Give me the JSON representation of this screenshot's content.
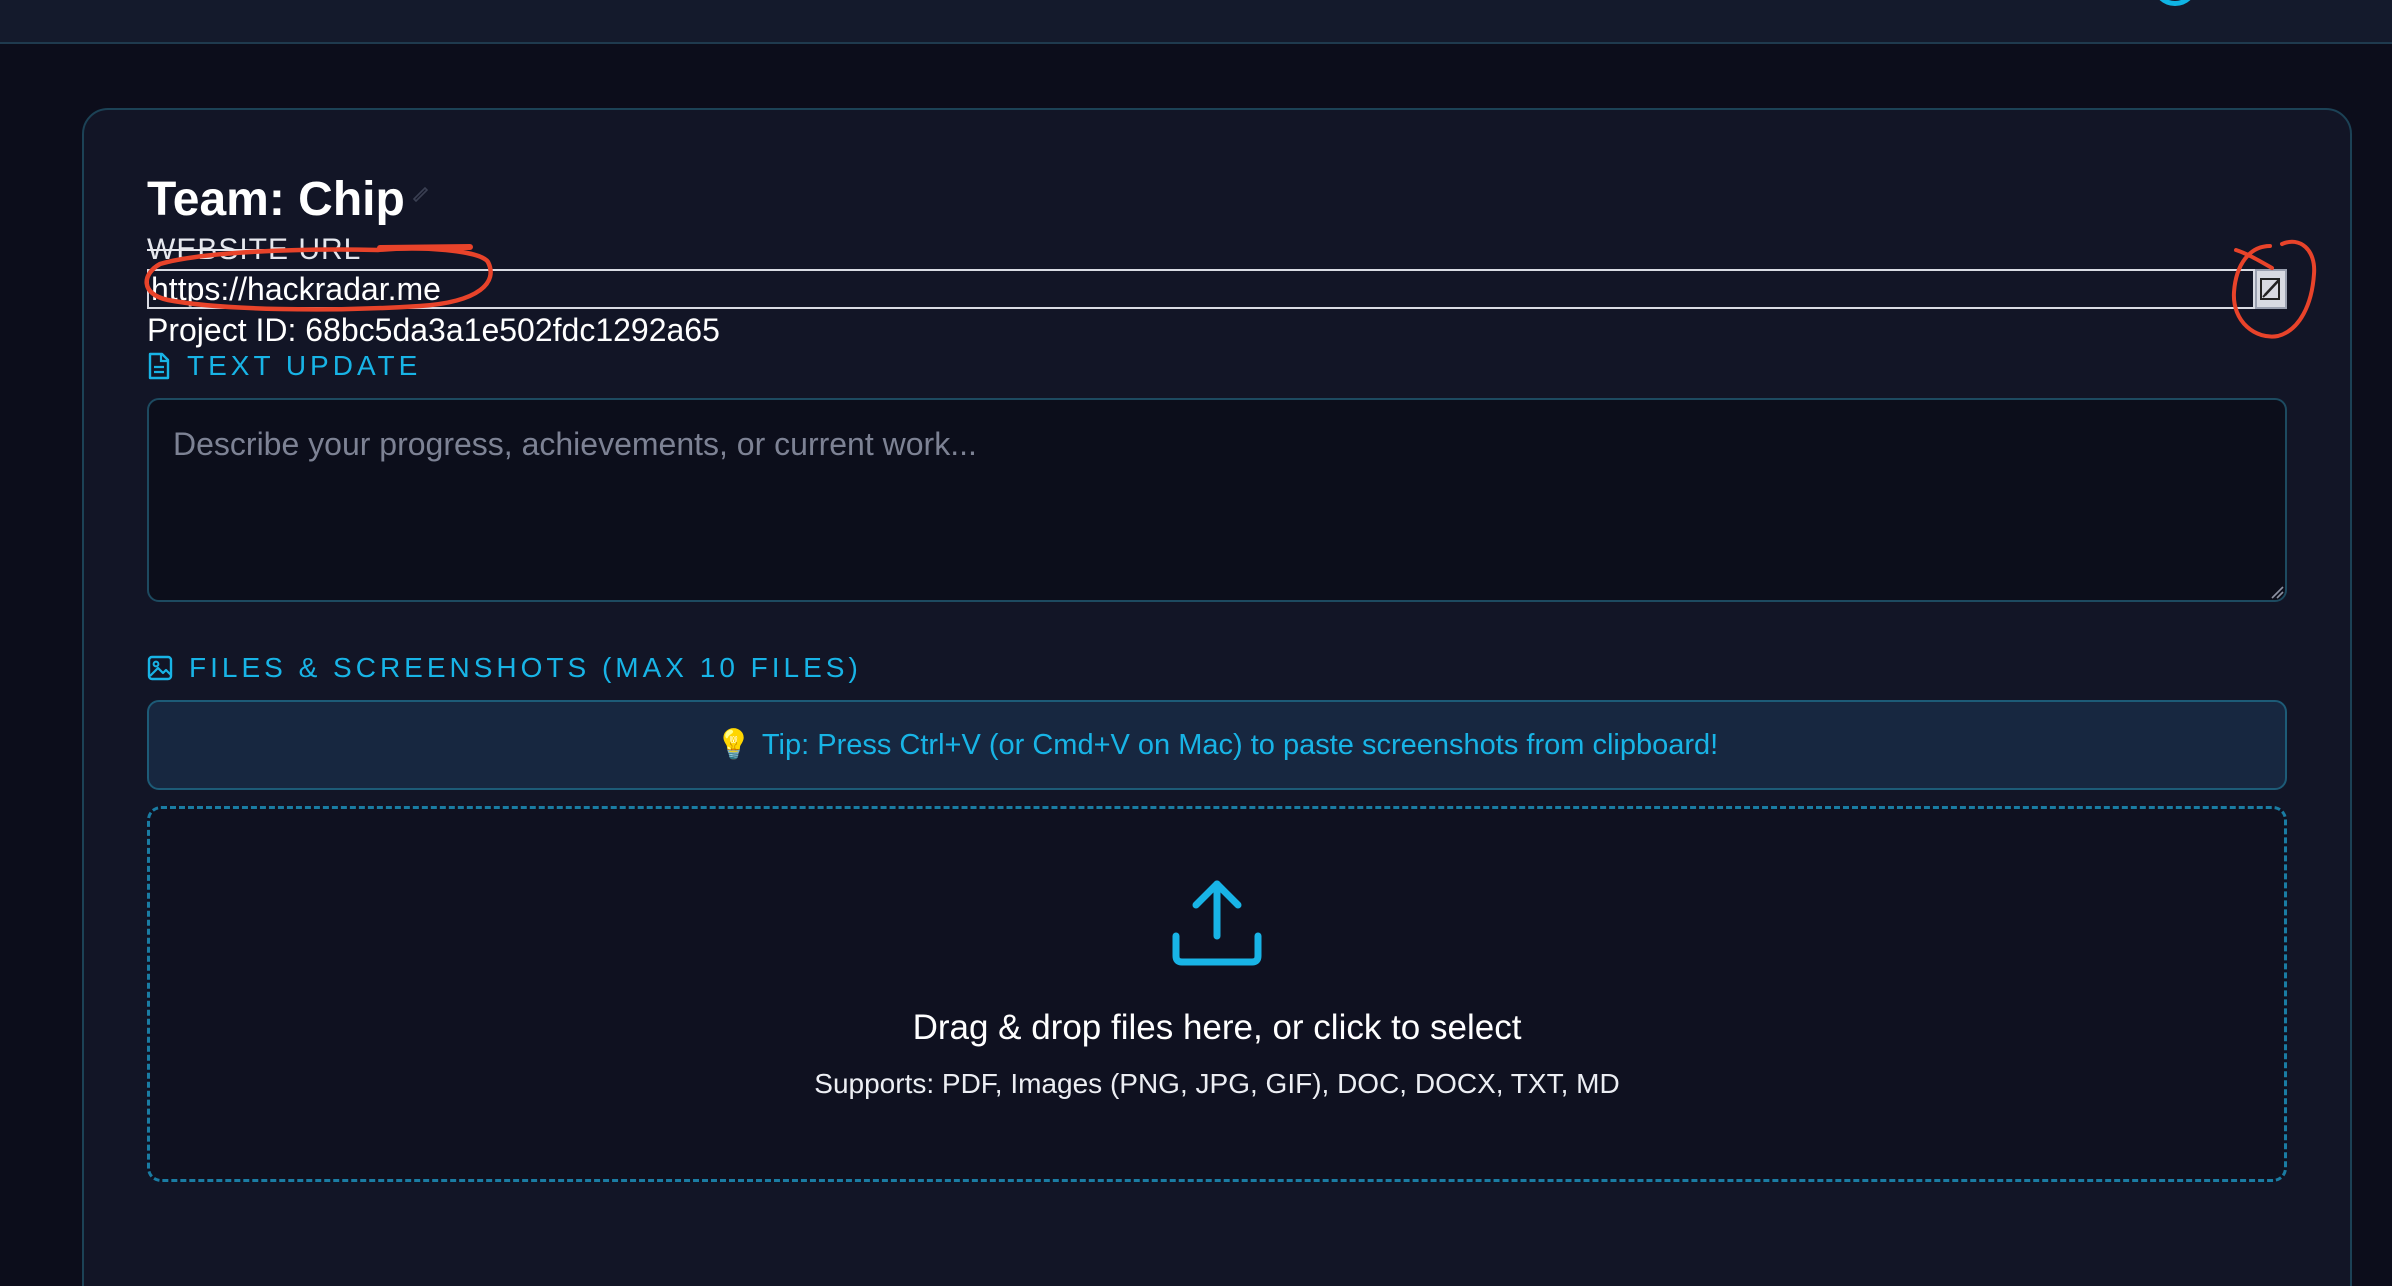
{
  "card": {
    "team_title": "Team: Chip",
    "website_label": "WEBSITE URL",
    "website_url": "https://hackradar.me",
    "project_id": "Project ID: 68bc5da3a1e502fdc1292a65"
  },
  "text_update": {
    "section_label": "TEXT UPDATE",
    "placeholder": "Describe your progress, achievements, or current work..."
  },
  "files": {
    "section_label": "FILES & SCREENSHOTS (MAX 10 FILES)",
    "tip_icon": "💡",
    "tip_text": "Tip: Press Ctrl+V (or Cmd+V on Mac) to paste screenshots from clipboard!",
    "drop_main": "Drag & drop files here, or click to select",
    "drop_sub": "Supports: PDF, Images (PNG, JPG, GIF), DOC, DOCX, TXT, MD"
  },
  "icons": {
    "title_edit": "pencil-icon",
    "url_edit": "edit-icon",
    "text_update": "document-icon",
    "files": "image-icon",
    "tip": "lightbulb-icon",
    "dropzone": "upload-icon"
  },
  "colors": {
    "background": "#0c0d1b",
    "card": "#121526",
    "accent": "#18b4e6",
    "annotation": "#e8432a"
  }
}
